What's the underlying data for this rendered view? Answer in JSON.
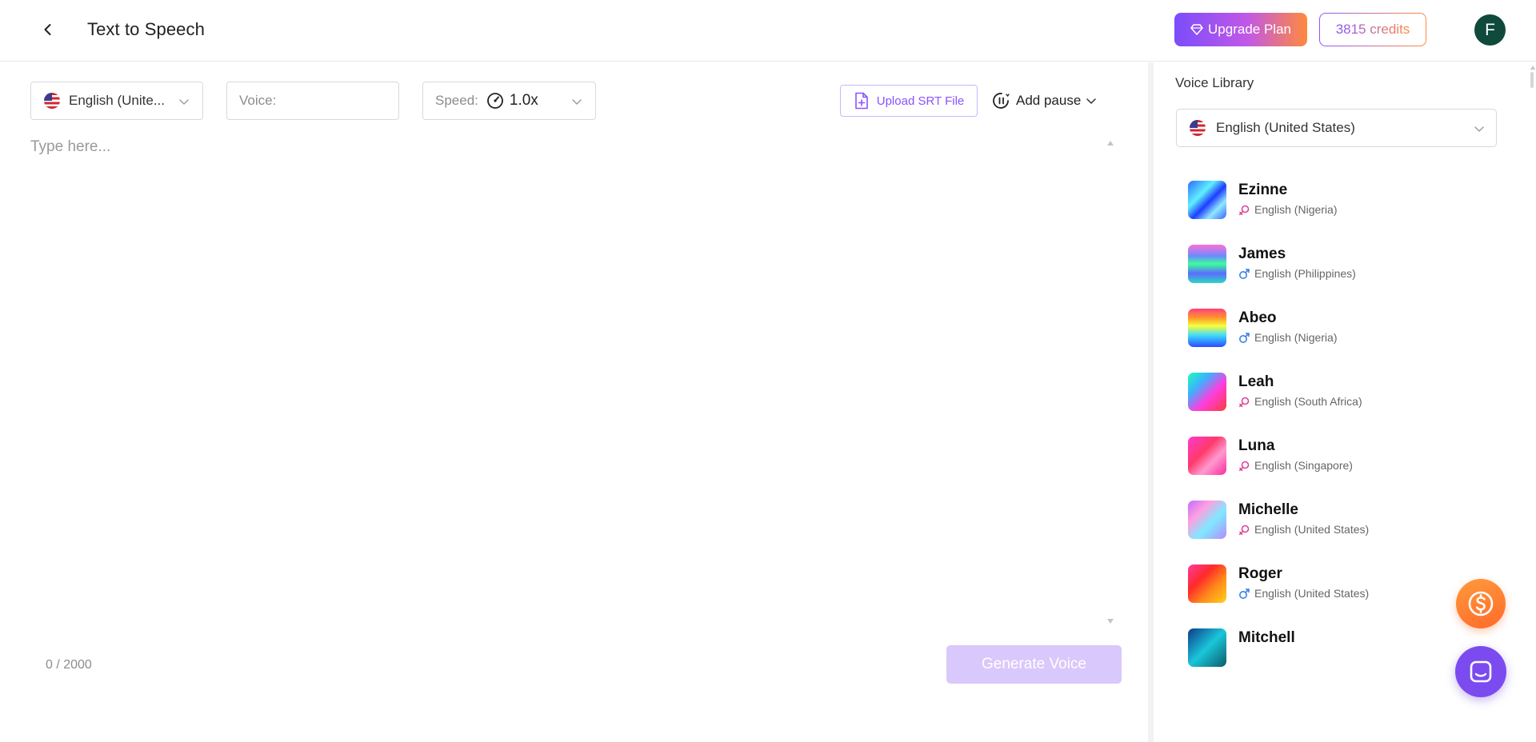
{
  "header": {
    "title": "Text to Speech",
    "upgrade_label": "Upgrade Plan",
    "credits_label": "3815 credits",
    "avatar_initial": "F"
  },
  "editor": {
    "language_value": "English (Unite...",
    "voice_placeholder": "Voice:",
    "speed_label": "Speed:",
    "speed_value": "1.0x",
    "upload_label": "Upload SRT File",
    "pause_label": "Add pause",
    "text_placeholder": "Type here...",
    "char_count": "0 / 2000",
    "generate_label": "Generate Voice"
  },
  "library": {
    "title": "Voice Library",
    "language_value": "English (United States)",
    "voices": [
      {
        "name": "Ezinne",
        "accent": "English (Nigeria)",
        "gender": "female"
      },
      {
        "name": "James",
        "accent": "English (Philippines)",
        "gender": "male"
      },
      {
        "name": "Abeo",
        "accent": "English (Nigeria)",
        "gender": "male"
      },
      {
        "name": "Leah",
        "accent": "English (South Africa)",
        "gender": "female"
      },
      {
        "name": "Luna",
        "accent": "English (Singapore)",
        "gender": "female"
      },
      {
        "name": "Michelle",
        "accent": "English (United States)",
        "gender": "female"
      },
      {
        "name": "Roger",
        "accent": "English (United States)",
        "gender": "male"
      },
      {
        "name": "Mitchell",
        "accent": "",
        "gender": ""
      }
    ]
  },
  "colors": {
    "brand_purple": "#8a52ff",
    "brand_orange": "#ff8a3d",
    "female_icon": "#e0429b",
    "male_icon": "#3b82e6",
    "generate_disabled": "#d9c8fb"
  },
  "icons": {
    "back": "chevron-left-icon",
    "upgrade": "diamond-icon",
    "speed": "gauge-icon",
    "upload": "file-add-icon",
    "pause": "pause-icon",
    "coin": "dollar-coin-icon",
    "chat": "chat-icon"
  }
}
